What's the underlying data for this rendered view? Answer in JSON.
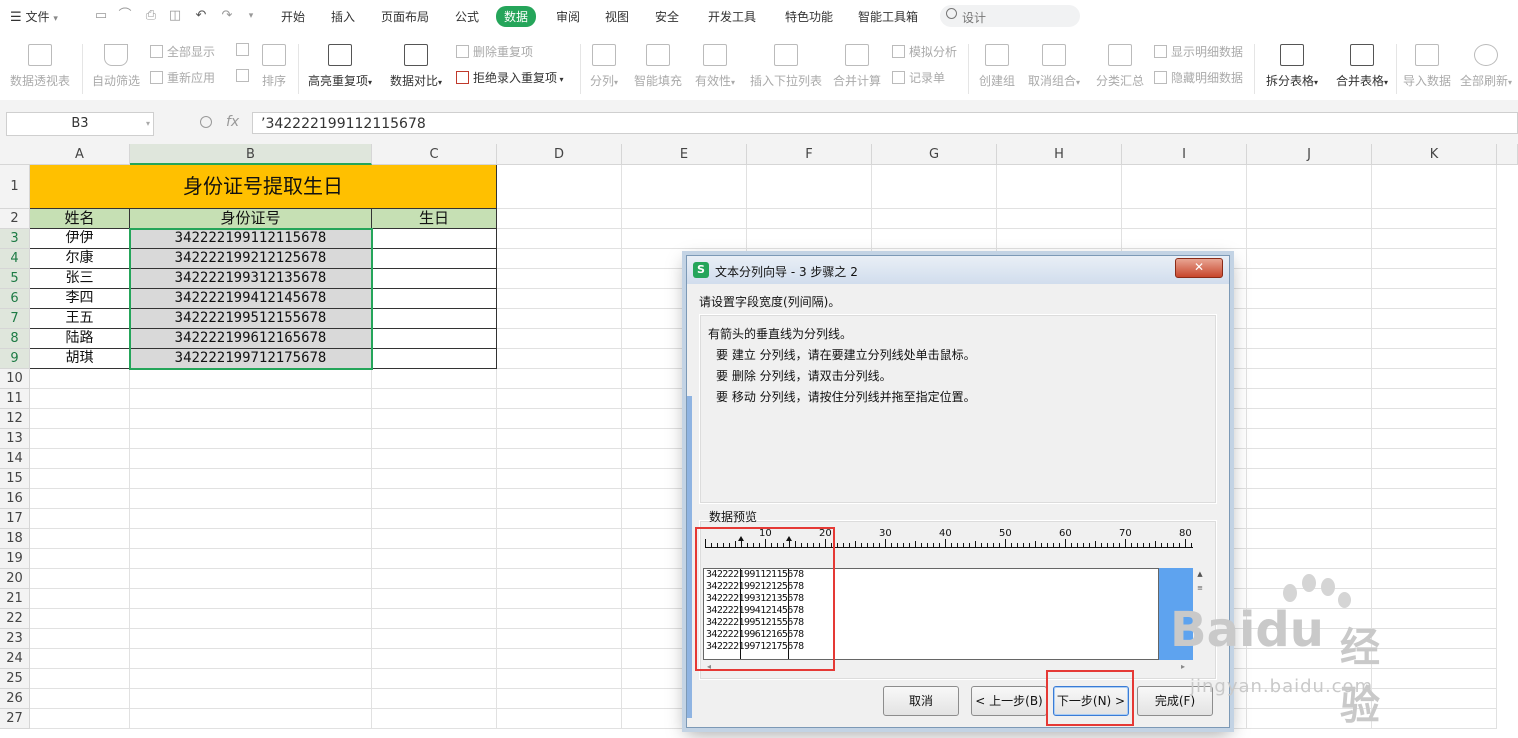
{
  "menubar": {
    "file_label": "文件",
    "tabs": [
      "开始",
      "插入",
      "页面布局",
      "公式",
      "数据",
      "审阅",
      "视图",
      "安全",
      "开发工具",
      "特色功能",
      "智能工具箱"
    ],
    "active_tab": "数据",
    "search_placeholder": "设计"
  },
  "ribbon": {
    "pivot": "数据透视表",
    "autofilter": "自动筛选",
    "show_all": "全部显示",
    "reapply": "重新应用",
    "sort": "排序",
    "highlight_dup": "高亮重复项",
    "data_compare": "数据对比",
    "delete_dup": "删除重复项",
    "reject_dup": "拒绝录入重复项",
    "split_col": "分列",
    "smart_fill": "智能填充",
    "validity": "有效性",
    "insert_dropdown": "插入下拉列表",
    "consolidate": "合并计算",
    "whatif": "模拟分析",
    "record_form": "记录单",
    "create_group": "创建组",
    "ungroup": "取消组合",
    "subtotal": "分类汇总",
    "show_detail": "显示明细数据",
    "hide_detail": "隐藏明细数据",
    "split_table": "拆分表格",
    "merge_table": "合并表格",
    "import_data": "导入数据",
    "refresh_all": "全部刷新"
  },
  "formula_bar": {
    "cell_ref": "B3",
    "fx_label": "fx",
    "content": "’342222199112115678"
  },
  "sheet": {
    "columns": [
      "A",
      "B",
      "C",
      "D",
      "E",
      "F",
      "G",
      "H",
      "I",
      "J",
      "K"
    ],
    "rows": [
      "1",
      "2",
      "3",
      "4",
      "5",
      "6",
      "7",
      "8",
      "9",
      "10",
      "11",
      "12",
      "13",
      "14",
      "15",
      "16",
      "17",
      "18",
      "19",
      "20",
      "21",
      "22",
      "23",
      "24",
      "25",
      "26",
      "27"
    ],
    "title": "身份证号提取生日",
    "headers": [
      "姓名",
      "身份证号",
      "生日"
    ],
    "records": [
      {
        "name": "伊伊",
        "id": "342222199112115678"
      },
      {
        "name": "尔康",
        "id": "342222199212125678"
      },
      {
        "name": "张三",
        "id": "342222199312135678"
      },
      {
        "name": "李四",
        "id": "342222199412145678"
      },
      {
        "name": "王五",
        "id": "342222199512155678"
      },
      {
        "name": "陆路",
        "id": "342222199612165678"
      },
      {
        "name": "胡琪",
        "id": "342222199712175678"
      }
    ]
  },
  "dialog": {
    "title": "文本分列向导 - 3 步骤之 2",
    "subtitle": "请设置字段宽度(列间隔)。",
    "info": [
      "有箭头的垂直线为分列线。",
      "要 建立 分列线，请在要建立分列线处单击鼠标。",
      "要 删除 分列线，请双击分列线。",
      "要 移动 分列线，请按住分列线并拖至指定位置。"
    ],
    "preview_label": "数据预览",
    "ruler_numbers": [
      "10",
      "20",
      "30",
      "40",
      "50",
      "60",
      "70",
      "80"
    ],
    "buttons": {
      "cancel": "取消",
      "prev": "< 上一步(B)",
      "next": "下一步(N) >",
      "finish": "完成(F)"
    }
  },
  "watermark": {
    "brand": "Baidu",
    "brand_cn": "经验",
    "url": "jingyan.baidu.com"
  },
  "colors": {
    "accent": "#25a55a",
    "title_fill": "#ffc000",
    "header_fill": "#c6e0b4",
    "id_fill": "#d9d9d9",
    "highlight_red": "#e53935",
    "scroll_blue": "#5ea3ef"
  }
}
